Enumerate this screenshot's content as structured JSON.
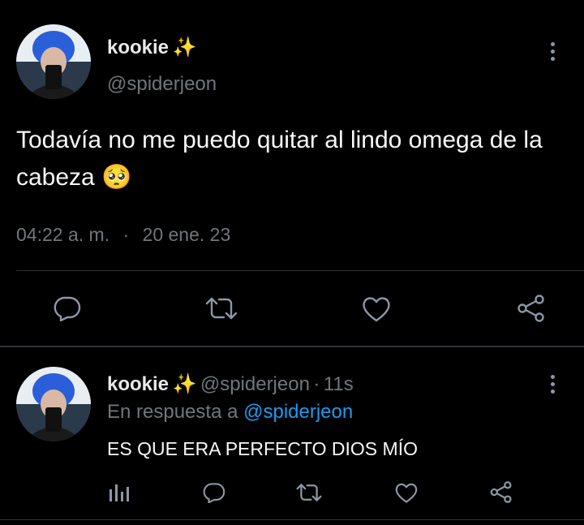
{
  "main_tweet": {
    "display_name": "kookie",
    "name_emoji": "✨",
    "handle": "@spiderjeon",
    "text": "Todavía no me puedo quitar al lindo omega de la cabeza",
    "text_emoji": "🥺",
    "time": "04:22 a. m.",
    "separator": "·",
    "date": "20 ene. 23",
    "actions": [
      "reply-icon",
      "retweet-icon",
      "like-icon",
      "share-icon"
    ]
  },
  "reply_tweet": {
    "display_name": "kookie",
    "name_emoji": "✨",
    "handle": "@spiderjeon",
    "separator": "·",
    "time_ago": "11s",
    "replying_prefix": "En respuesta a",
    "replying_to": "@spiderjeon",
    "text": "ES QUE ERA PERFECTO DIOS MÍO",
    "actions": [
      "analytics-icon",
      "reply-icon",
      "retweet-icon",
      "like-icon",
      "share-icon"
    ]
  },
  "colors": {
    "background": "#000000",
    "text": "#e7e9ea",
    "secondary": "#71767b",
    "link": "#1d9bf0",
    "divider": "#2f3336"
  }
}
